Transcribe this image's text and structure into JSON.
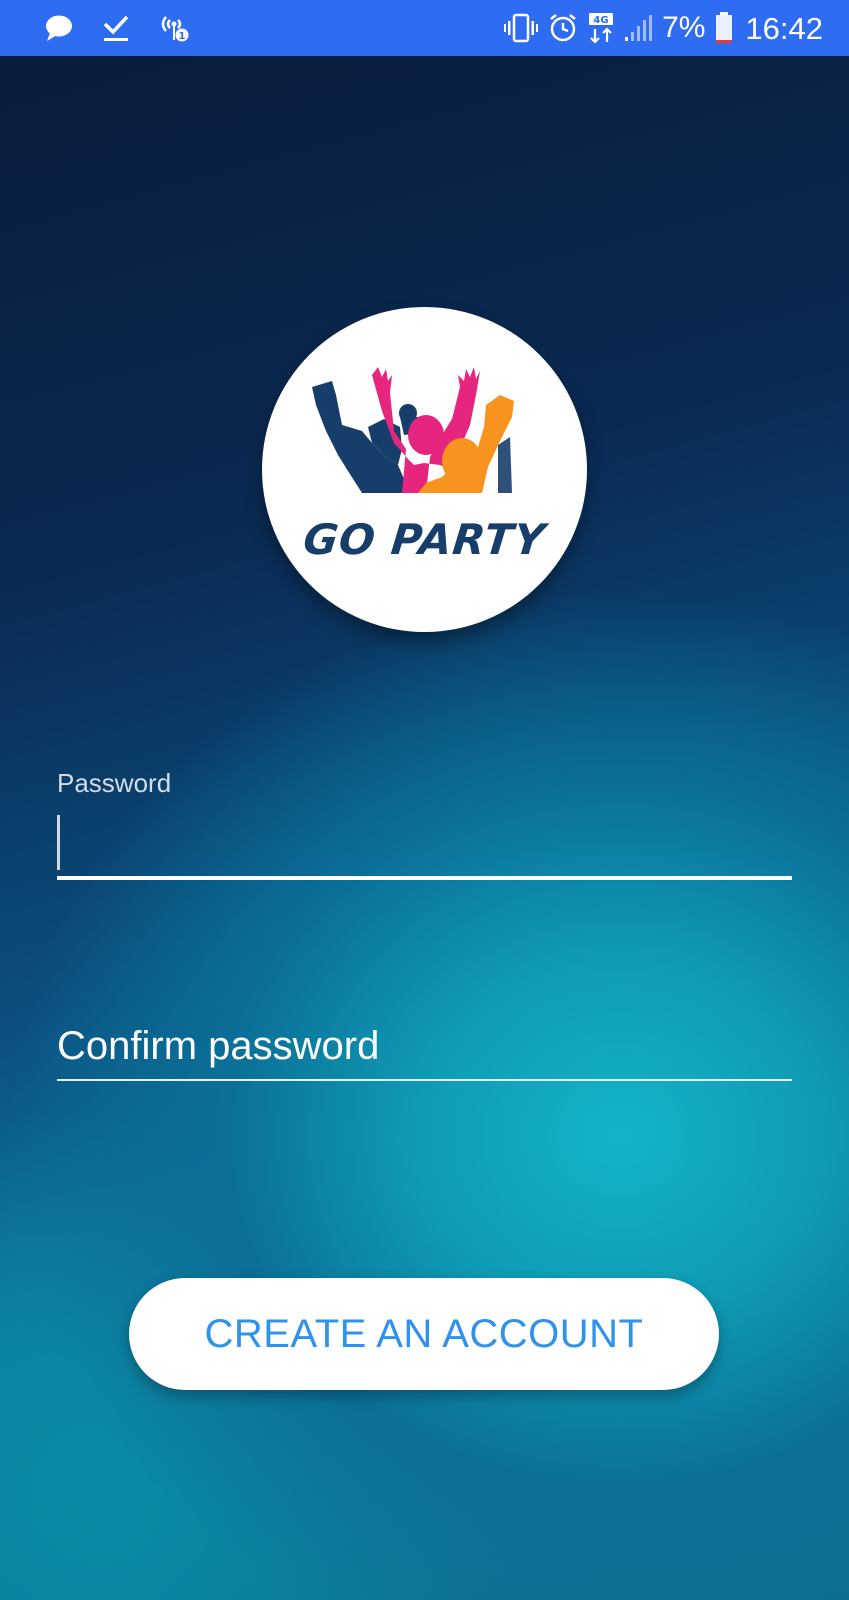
{
  "status_bar": {
    "left_icons": [
      "chat-bubble-icon",
      "checkmark-icon",
      "hotspot-icon"
    ],
    "right_icons": [
      "vibrate-icon",
      "alarm-clock-icon",
      "network-4g-icon",
      "signal-icon",
      "battery-icon"
    ],
    "network_label": "4G",
    "battery_percent": "7%",
    "time": "16:42"
  },
  "logo": {
    "text": "GO PARTY",
    "colors": {
      "navy": "#173d6b",
      "pink": "#e6267e",
      "orange": "#f7931e"
    }
  },
  "form": {
    "password": {
      "label": "Password",
      "value": ""
    },
    "confirm_password": {
      "placeholder": "Confirm password",
      "value": ""
    }
  },
  "actions": {
    "create_account_label": "CREATE AN ACCOUNT"
  },
  "colors": {
    "status_bar": "#2e6cf2",
    "button_text": "#2f93ee",
    "bg_dark": "#0a1c3c",
    "bg_teal": "#13b3c9"
  }
}
